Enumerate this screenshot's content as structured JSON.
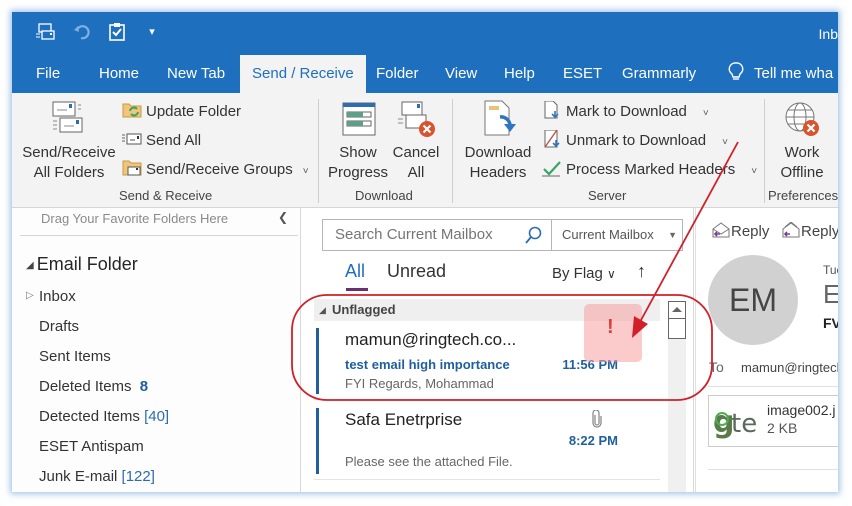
{
  "quick_access": {
    "items": [
      {
        "name": "send-receive-all-icon"
      },
      {
        "name": "undo-icon"
      },
      {
        "name": "clipboard-check-icon"
      },
      {
        "name": "customize-qat-icon",
        "glyph": "▾"
      }
    ]
  },
  "title_fragment": "Inb",
  "tabs": [
    {
      "label": "File"
    },
    {
      "label": "Home"
    },
    {
      "label": "New Tab"
    },
    {
      "label": "Send / Receive",
      "active": true
    },
    {
      "label": "Folder"
    },
    {
      "label": "View"
    },
    {
      "label": "Help"
    },
    {
      "label": "ESET"
    },
    {
      "label": "Grammarly"
    }
  ],
  "tell_me": "Tell me wha",
  "ribbon": {
    "send_receive": {
      "group_label": "Send & Receive",
      "big_button": {
        "line1": "Send/Receive",
        "line2": "All Folders"
      },
      "update_folder": "Update Folder",
      "send_all": "Send All",
      "groups": "Send/Receive Groups"
    },
    "download": {
      "group_label": "Download",
      "show_progress": {
        "line1": "Show",
        "line2": "Progress"
      },
      "cancel_all": {
        "line1": "Cancel",
        "line2": "All"
      }
    },
    "server": {
      "group_label": "Server",
      "download_headers": {
        "line1": "Download",
        "line2": "Headers"
      },
      "mark_to_download": "Mark to Download",
      "unmark_to_download": "Unmark to Download",
      "process_marked": "Process Marked Headers"
    },
    "preferences": {
      "group_label": "Preferences",
      "work_offline": {
        "line1": "Work",
        "line2": "Offline"
      }
    }
  },
  "folder_pane": {
    "favorites_hint": "Drag Your Favorite Folders Here",
    "collapse_glyph": "❮",
    "root": "Email Folder",
    "folders": [
      {
        "label": "Inbox",
        "count": "",
        "expandable": true
      },
      {
        "label": "Drafts",
        "count": ""
      },
      {
        "label": "Sent Items",
        "count": ""
      },
      {
        "label": "Deleted Items",
        "count": "8"
      },
      {
        "label": "Detected Items",
        "count": "[40]"
      },
      {
        "label": "ESET Antispam",
        "count": ""
      },
      {
        "label": "Junk E-mail",
        "count": "[122]"
      }
    ]
  },
  "message_list": {
    "search_placeholder": "Search Current Mailbox",
    "scope": "Current Mailbox",
    "filters": {
      "all": "All",
      "unread": "Unread"
    },
    "sort_by": "By Flag",
    "sort_direction": "↑",
    "group_header": "Unflagged",
    "messages": [
      {
        "sender": "mamun@ringtech.co...",
        "subject": "test email high importance",
        "preview": "FYI  Regards,  Mohammad",
        "time": "11:56 PM",
        "importance": "!"
      },
      {
        "sender": "Safa Enetrprise",
        "subject": "",
        "preview": "Please see the attached File.",
        "time": "8:22 PM",
        "has_attachment": true
      }
    ]
  },
  "reading_pane": {
    "reply": "Reply",
    "reply_all": "Reply",
    "avatar_initials": "EM",
    "date_fragment": "Tue",
    "sender_fragment": "Er",
    "subject_fragment": "FV",
    "to_label": "To",
    "to_value": "mamun@ringtech",
    "attachment": {
      "name": "image002.j",
      "size": "2 KB",
      "thumb_text": "gte"
    }
  },
  "annotation": {
    "color": "#d0202a"
  }
}
